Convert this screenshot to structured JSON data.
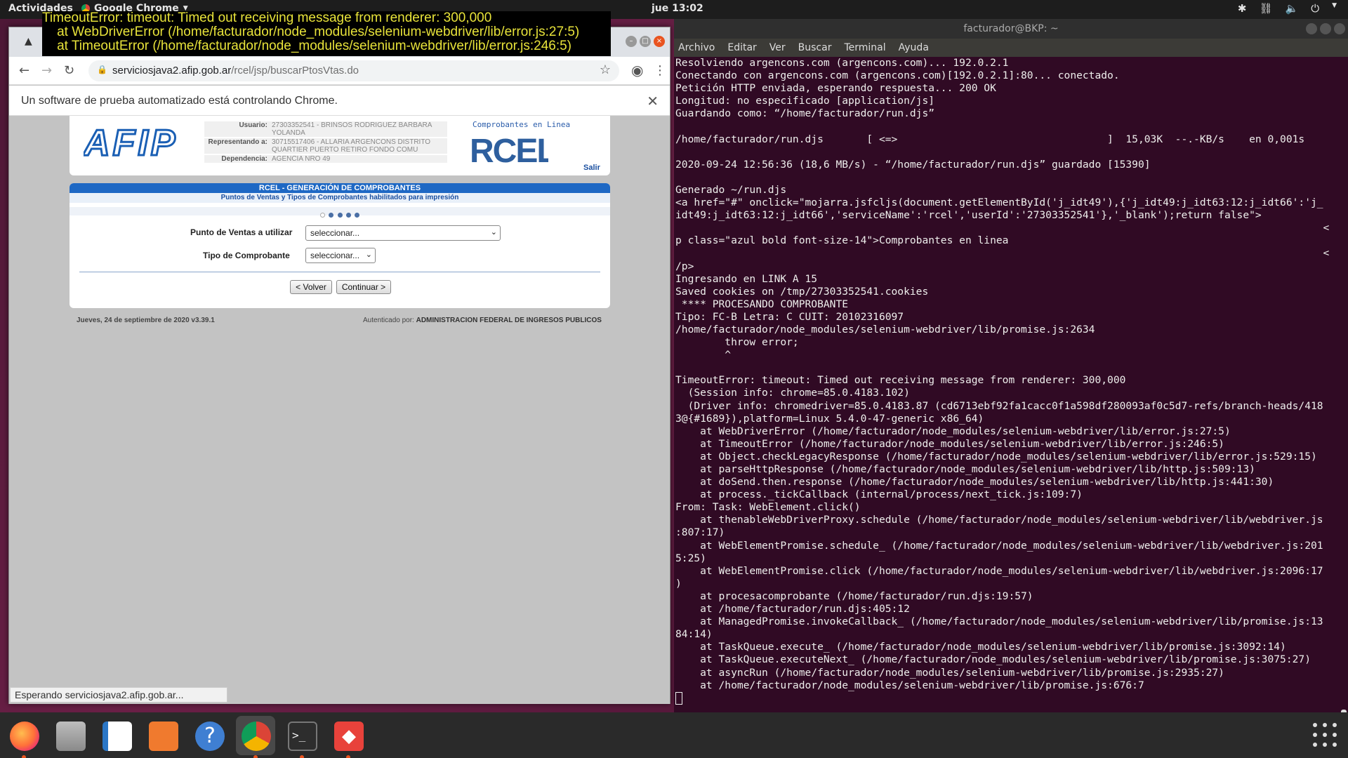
{
  "topbar": {
    "activities": "Actividades",
    "app_menu": "Google Chrome",
    "clock": "jue 13:02"
  },
  "error_overlay": {
    "lines": [
      "TimeoutError: timeout: Timed out receiving message from renderer: 300,000",
      "    at WebDriverError (/home/facturador/node_modules/selenium-webdriver/lib/error.js:27:5)",
      "    at TimeoutError (/home/facturador/node_modules/selenium-webdriver/lib/error.js:246:5)"
    ]
  },
  "chrome": {
    "url_domain": "serviciosjava2.afip.gob.ar",
    "url_path": "/rcel/jsp/buscarPtosVtas.do",
    "infobar": "Un software de prueba automatizado está controlando Chrome.",
    "status": "Esperando serviciosjava2.afip.gob.ar..."
  },
  "afip": {
    "usuario_label": "Usuario:",
    "usuario_value": "27303352541 - BRINSOS RODRIGUEZ BARBARA YOLANDA",
    "representando_label": "Representando a:",
    "representando_value": "30715517406 - ALLARIA ARGENCONS DISTRITO QUARTIER PUERTO RETIRO FONDO COMU",
    "dependencia_label": "Dependencia:",
    "dependencia_value": "AGENCIA NRO 49",
    "rcel_tagline": "Comprobantes en Linea",
    "salir": "Salir",
    "logo_text": "AFIP",
    "rcel_logo_text": "RCEL"
  },
  "form": {
    "title": "RCEL - GENERACIÓN DE COMPROBANTES",
    "subtitle": "Puntos de Ventas y Tipos de Comprobantes habilitados para impresión",
    "punto_label": "Punto de Ventas a utilizar",
    "punto_value": "seleccionar...",
    "tipo_label": "Tipo de Comprobante",
    "tipo_value": "seleccionar...",
    "volver": "< Volver",
    "continuar": "Continuar >"
  },
  "footer": {
    "left": "Jueves, 24 de septiembre de 2020 v3.39.1",
    "right_prefix": "Autenticado por:",
    "right_org": "ADMINISTRACION FEDERAL DE INGRESOS PUBLICOS"
  },
  "terminal": {
    "title": "facturador@BKP: ~",
    "menu": [
      "Archivo",
      "Editar",
      "Ver",
      "Buscar",
      "Terminal",
      "Ayuda"
    ],
    "text": "Resolviendo argencons.com (argencons.com)... 192.0.2.1\nConectando con argencons.com (argencons.com)[192.0.2.1]:80... conectado.\nPetición HTTP enviada, esperando respuesta... 200 OK\nLongitud: no especificado [application/js]\nGuardando como: “/home/facturador/run.djs”\n\n/home/facturador/run.djs       [ <=>                                  ]  15,03K  --.-KB/s    en 0,001s\n\n2020-09-24 12:56:36 (18,6 MB/s) - “/home/facturador/run.djs” guardado [15390]\n\nGenerado ~/run.djs\n<a href=\"#\" onclick=\"mojarra.jsfcljs(document.getElementById('j_idt49'),{'j_idt49:j_idt63:12:j_idt66':'j_\nidt49:j_idt63:12:j_idt66','serviceName':'rcel','userId':'27303352541'},'_blank');return false\">\n                                                                                                         <\np class=\"azul bold font-size-14\">Comprobantes en linea\n                                                                                                         <\n/p>\nIngresando en LINK A 15\nSaved cookies on /tmp/27303352541.cookies\n **** PROCESANDO COMPROBANTE\nTipo: FC-B Letra: C CUIT: 20102316097\n/home/facturador/node_modules/selenium-webdriver/lib/promise.js:2634\n        throw error;\n        ^\n\nTimeoutError: timeout: Timed out receiving message from renderer: 300,000\n  (Session info: chrome=85.0.4183.102)\n  (Driver info: chromedriver=85.0.4183.87 (cd6713ebf92fa1cacc0f1a598df280093af0c5d7-refs/branch-heads/418\n3@{#1689}),platform=Linux 5.4.0-47-generic x86_64)\n    at WebDriverError (/home/facturador/node_modules/selenium-webdriver/lib/error.js:27:5)\n    at TimeoutError (/home/facturador/node_modules/selenium-webdriver/lib/error.js:246:5)\n    at Object.checkLegacyResponse (/home/facturador/node_modules/selenium-webdriver/lib/error.js:529:15)\n    at parseHttpResponse (/home/facturador/node_modules/selenium-webdriver/lib/http.js:509:13)\n    at doSend.then.response (/home/facturador/node_modules/selenium-webdriver/lib/http.js:441:30)\n    at process._tickCallback (internal/process/next_tick.js:109:7)\nFrom: Task: WebElement.click()\n    at thenableWebDriverProxy.schedule (/home/facturador/node_modules/selenium-webdriver/lib/webdriver.js\n:807:17)\n    at WebElementPromise.schedule_ (/home/facturador/node_modules/selenium-webdriver/lib/webdriver.js:201\n5:25)\n    at WebElementPromise.click (/home/facturador/node_modules/selenium-webdriver/lib/webdriver.js:2096:17\n)\n    at procesacomprobante (/home/facturador/run.djs:19:57)\n    at /home/facturador/run.djs:405:12\n    at ManagedPromise.invokeCallback_ (/home/facturador/node_modules/selenium-webdriver/lib/promise.js:13\n84:14)\n    at TaskQueue.execute_ (/home/facturador/node_modules/selenium-webdriver/lib/promise.js:3092:14)\n    at TaskQueue.executeNext_ (/home/facturador/node_modules/selenium-webdriver/lib/promise.js:3075:27)\n    at asyncRun (/home/facturador/node_modules/selenium-webdriver/lib/promise.js:2935:27)\n    at /home/facturador/node_modules/selenium-webdriver/lib/promise.js:676:7"
  },
  "dock": {
    "items": [
      "firefox-icon",
      "files-icon",
      "writer-icon",
      "software-icon",
      "help-icon",
      "chrome-icon",
      "terminal-icon",
      "anydesk-icon"
    ]
  },
  "colors": {
    "terminal_bg": "#300a24",
    "error_text": "#e8e33a",
    "afip_blue": "#1e68c4",
    "ubuntu_orange": "#e95420"
  }
}
